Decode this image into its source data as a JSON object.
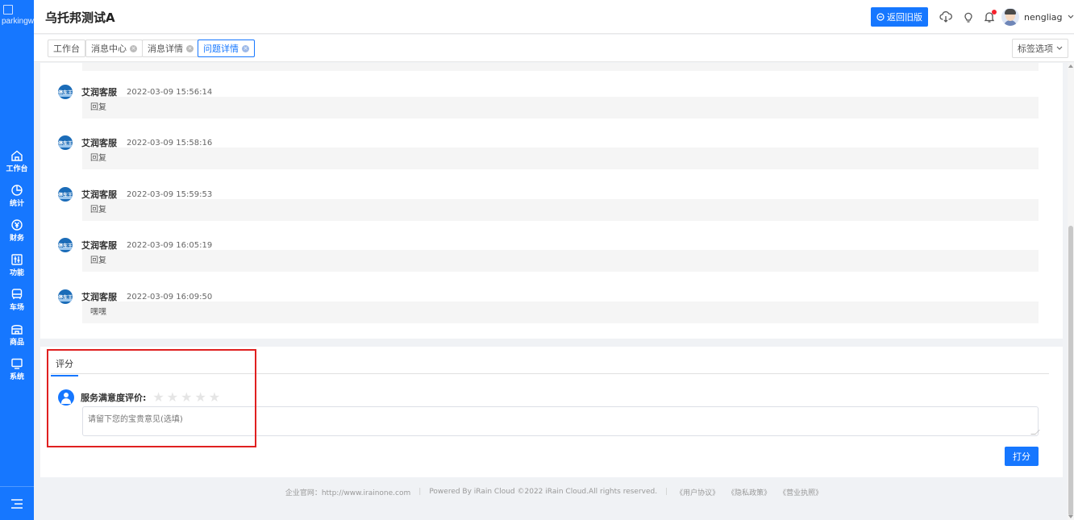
{
  "logo": {
    "alt": "parkingwang"
  },
  "header": {
    "title": "乌托邦测试A",
    "back_old_label": "返回旧版",
    "username": "nengliag"
  },
  "sidebar": {
    "items": [
      {
        "label": "工作台",
        "icon": "home-icon"
      },
      {
        "label": "统计",
        "icon": "chart-pie-icon"
      },
      {
        "label": "财务",
        "icon": "yuan-icon"
      },
      {
        "label": "功能",
        "icon": "function-icon"
      },
      {
        "label": "车场",
        "icon": "car-icon"
      },
      {
        "label": "商品",
        "icon": "shop-icon"
      },
      {
        "label": "系统",
        "icon": "monitor-icon"
      }
    ]
  },
  "tabs": [
    {
      "label": "工作台"
    },
    {
      "label": "消息中心"
    },
    {
      "label": "消息详情"
    },
    {
      "label": "问题详情"
    }
  ],
  "tab_options_label": "标签选项",
  "replies": [
    {
      "author": "艾润客服",
      "time": "2022-03-09 15:56:14",
      "content": "回复"
    },
    {
      "author": "艾润客服",
      "time": "2022-03-09 15:58:16",
      "content": "回复"
    },
    {
      "author": "艾润客服",
      "time": "2022-03-09 15:59:53",
      "content": "回复"
    },
    {
      "author": "艾润客服",
      "time": "2022-03-09 16:05:19",
      "content": "回复"
    },
    {
      "author": "艾润客服",
      "time": "2022-03-09 16:09:50",
      "content": "嘿嘿"
    }
  ],
  "avatar_badge": "停车王",
  "rating": {
    "tab_label": "评分",
    "satisfaction_label": "服务满意度评价:",
    "stars_total": 5,
    "stars_selected": 0,
    "comment_placeholder": "请留下您的宝贵意见(选填)",
    "submit_label": "打分"
  },
  "footer": {
    "website": "企业官网：http://www.irainone.com",
    "copyright": "Powered By iRain Cloud ©2022 iRain Cloud.All rights reserved.",
    "user_agreement": "《用户协议》",
    "privacy": "《隐私政策》",
    "license": "《营业执照》"
  },
  "colors": {
    "primary": "#1677ff",
    "highlight": "#e02020"
  }
}
